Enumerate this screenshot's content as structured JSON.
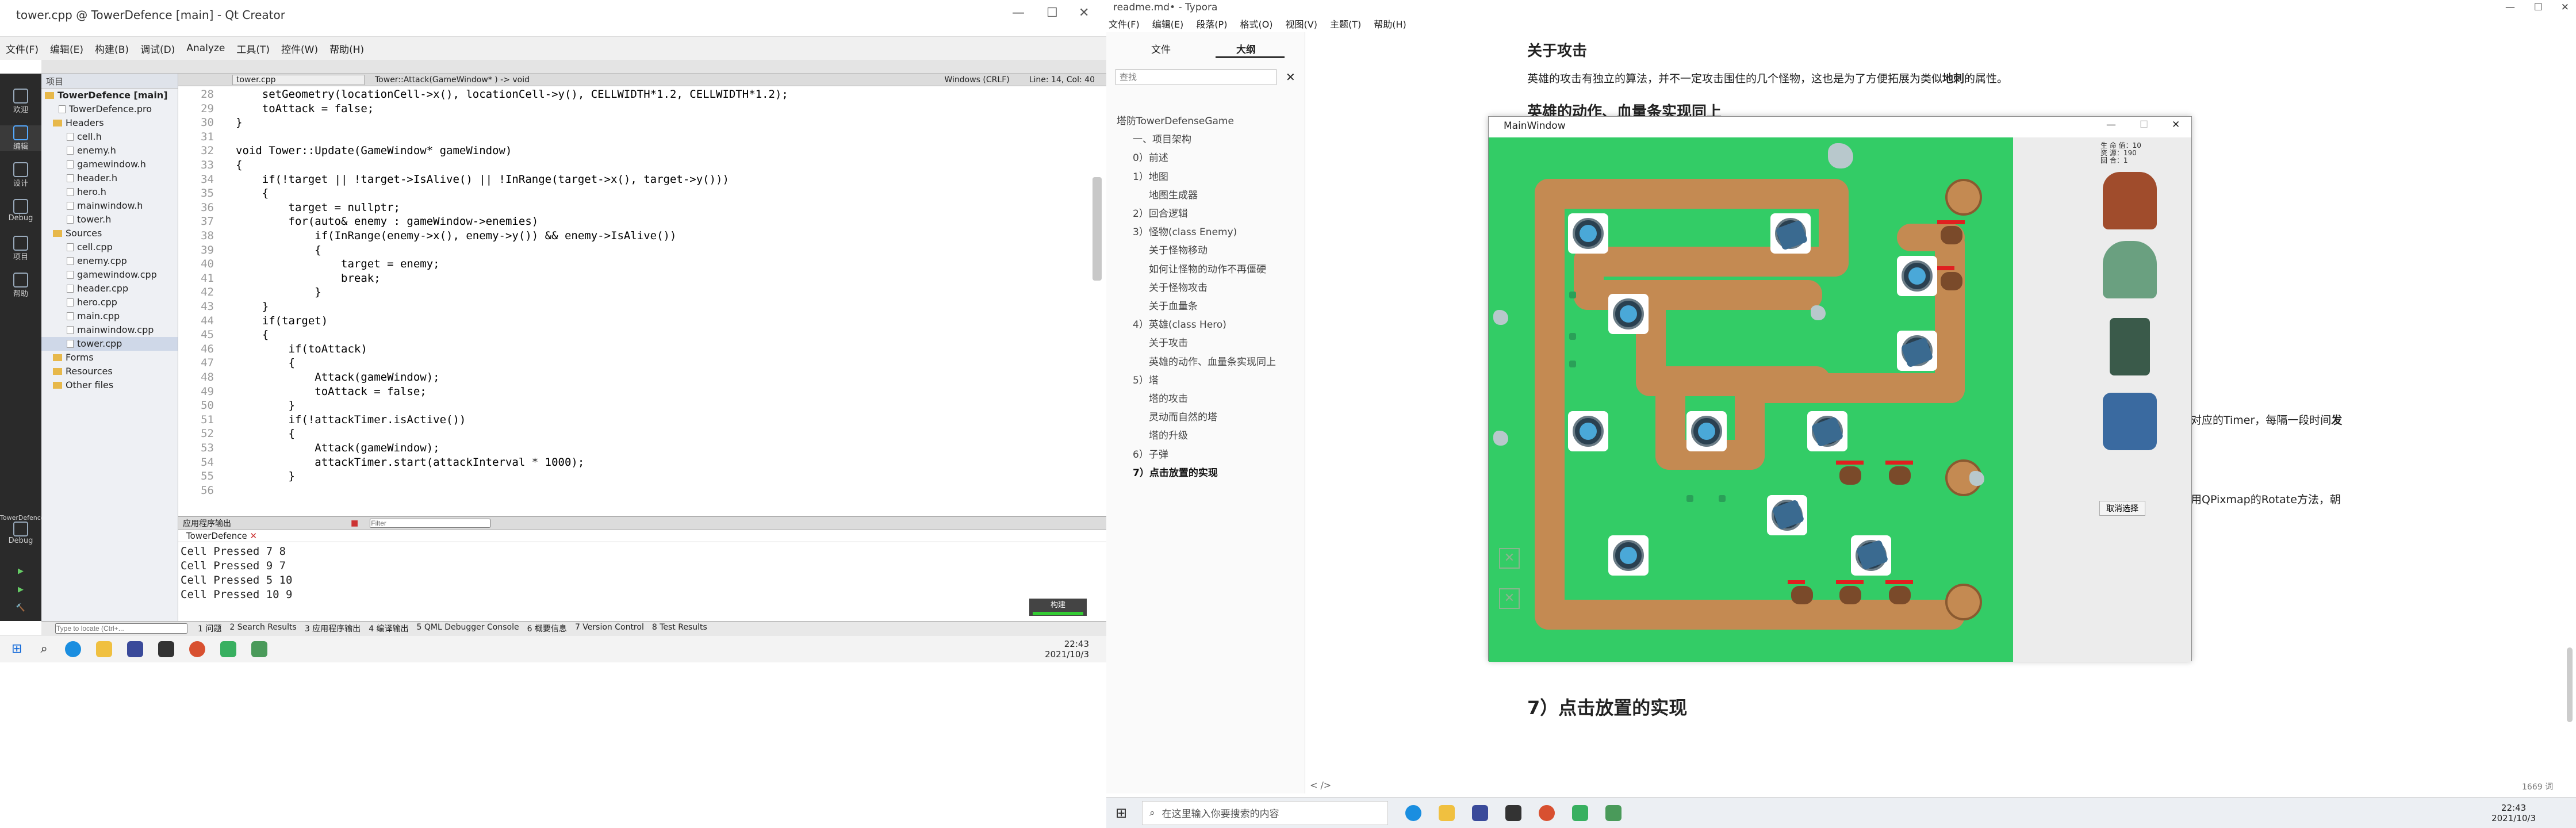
{
  "qt": {
    "title": "tower.cpp @ TowerDefence [main] - Qt Creator",
    "menu": [
      "文件(F)",
      "编辑(E)",
      "构建(B)",
      "调试(D)",
      "Analyze",
      "工具(T)",
      "控件(W)",
      "帮助(H)"
    ],
    "modes": [
      "欢迎",
      "编辑",
      "设计",
      "Debug",
      "项目",
      "帮助"
    ],
    "proj_header": "项目",
    "tree": [
      {
        "label": "TowerDefence [main]",
        "type": "root"
      },
      {
        "label": "TowerDefence.pro",
        "type": "file"
      },
      {
        "label": "Headers",
        "type": "folder"
      },
      {
        "label": "cell.h",
        "type": "file"
      },
      {
        "label": "enemy.h",
        "type": "file"
      },
      {
        "label": "gamewindow.h",
        "type": "file"
      },
      {
        "label": "header.h",
        "type": "file"
      },
      {
        "label": "hero.h",
        "type": "file"
      },
      {
        "label": "mainwindow.h",
        "type": "file"
      },
      {
        "label": "tower.h",
        "type": "file"
      },
      {
        "label": "Sources",
        "type": "folder"
      },
      {
        "label": "cell.cpp",
        "type": "file"
      },
      {
        "label": "enemy.cpp",
        "type": "file"
      },
      {
        "label": "gamewindow.cpp",
        "type": "file"
      },
      {
        "label": "header.cpp",
        "type": "file"
      },
      {
        "label": "hero.cpp",
        "type": "file"
      },
      {
        "label": "main.cpp",
        "type": "file"
      },
      {
        "label": "mainwindow.cpp",
        "type": "file"
      },
      {
        "label": "tower.cpp",
        "type": "file"
      },
      {
        "label": "Forms",
        "type": "folder"
      },
      {
        "label": "Resources",
        "type": "folder"
      },
      {
        "label": "Other files",
        "type": "folder"
      }
    ],
    "editor_file": "tower.cpp",
    "editor_symbol": "Tower::Attack(GameWindow* ) -> void",
    "editor_encoding": "Windows (CRLF)",
    "editor_pos": "Line: 14, Col: 40",
    "code": [
      {
        "n": "28",
        "t": "    setGeometry(locationCell->x(), locationCell->y(), CELLWIDTH*1.2, CELLWIDTH*1.2);"
      },
      {
        "n": "29",
        "t": "    toAttack = false;"
      },
      {
        "n": "30",
        "t": "}"
      },
      {
        "n": "31",
        "t": ""
      },
      {
        "n": "32",
        "t": "void Tower::Update(GameWindow* gameWindow)"
      },
      {
        "n": "33",
        "t": "{"
      },
      {
        "n": "34",
        "t": "    if(!target || !target->IsAlive() || !InRange(target->x(), target->y()))"
      },
      {
        "n": "35",
        "t": "    {"
      },
      {
        "n": "36",
        "t": "        target = nullptr;"
      },
      {
        "n": "37",
        "t": "        for(auto& enemy : gameWindow->enemies)"
      },
      {
        "n": "38",
        "t": "            if(InRange(enemy->x(), enemy->y()) && enemy->IsAlive())"
      },
      {
        "n": "39",
        "t": "            {"
      },
      {
        "n": "40",
        "t": "                target = enemy;"
      },
      {
        "n": "41",
        "t": "                break;"
      },
      {
        "n": "42",
        "t": "            }"
      },
      {
        "n": "43",
        "t": "    }"
      },
      {
        "n": "44",
        "t": "    if(target)"
      },
      {
        "n": "45",
        "t": "    {"
      },
      {
        "n": "46",
        "t": "        if(toAttack)"
      },
      {
        "n": "47",
        "t": "        {"
      },
      {
        "n": "48",
        "t": "            Attack(gameWindow);"
      },
      {
        "n": "49",
        "t": "            toAttack = false;"
      },
      {
        "n": "50",
        "t": "        }"
      },
      {
        "n": "51",
        "t": "        if(!attackTimer.isActive())"
      },
      {
        "n": "52",
        "t": "        {"
      },
      {
        "n": "53",
        "t": "            Attack(gameWindow);"
      },
      {
        "n": "54",
        "t": "            attackTimer.start(attackInterval * 1000);"
      },
      {
        "n": "55",
        "t": "        }"
      },
      {
        "n": "56",
        "t": ""
      }
    ],
    "output_header": "应用程序输出",
    "output_tab": "TowerDefence",
    "output_filter_placeholder": "Filter",
    "output_lines": [
      "Cell Pressed 7 8",
      "Cell Pressed 9 7",
      "Cell Pressed 5 10",
      "Cell Pressed 10 9"
    ],
    "build_badge": "构建",
    "locate_placeholder": "Type to locate (Ctrl+...",
    "status_tabs": [
      "1 问题",
      "2 Search Results",
      "3 应用程序输出",
      "4 编译输出",
      "5 QML Debugger Console",
      "6 概要信息",
      "7 Version Control",
      "8 Test Results"
    ],
    "left_kit": "TowerDefence",
    "left_kit_mode": "Debug",
    "clock_time": "22:43",
    "clock_date": "2021/10/3"
  },
  "typora": {
    "title": "readme.md• - Typora",
    "menu": [
      "文件(F)",
      "编辑(E)",
      "段落(P)",
      "格式(O)",
      "视图(V)",
      "主题(T)",
      "帮助(H)"
    ],
    "tabs": [
      "文件",
      "大纲"
    ],
    "search_placeholder": "查找",
    "outline": [
      {
        "t": "塔防TowerDefenseGame",
        "lvl": 0
      },
      {
        "t": "一、项目架构",
        "lvl": 1
      },
      {
        "t": "0）前述",
        "lvl": 1
      },
      {
        "t": "1）地图",
        "lvl": 1
      },
      {
        "t": "地图生成器",
        "lvl": 2
      },
      {
        "t": "2）回合逻辑",
        "lvl": 1
      },
      {
        "t": "3）怪物(class Enemy)",
        "lvl": 1
      },
      {
        "t": "关于怪物移动",
        "lvl": 2
      },
      {
        "t": "如何让怪物的动作不再僵硬",
        "lvl": 2
      },
      {
        "t": "关于怪物攻击",
        "lvl": 2
      },
      {
        "t": "关于血量条",
        "lvl": 2
      },
      {
        "t": "4）英雄(class Hero)",
        "lvl": 1
      },
      {
        "t": "关于攻击",
        "lvl": 2
      },
      {
        "t": "英雄的动作、血量条实现同上",
        "lvl": 2
      },
      {
        "t": "5）塔",
        "lvl": 1
      },
      {
        "t": "塔的攻击",
        "lvl": 2
      },
      {
        "t": "灵动而自然的塔",
        "lvl": 2
      },
      {
        "t": "塔的升级",
        "lvl": 2
      },
      {
        "t": "6）子弹",
        "lvl": 1
      },
      {
        "t": "7）点击放置的实现",
        "lvl": 1,
        "active": true
      }
    ],
    "h_attack": "关于攻击",
    "p_attack_a": "英雄的攻击有独立的算法，并不一定攻击围住的几个怪物，这也是为了方便拓展为类似",
    "p_attack_b": "地刺",
    "p_attack_c": "的属性。",
    "h_hero": "英雄的动作、血量条实现同上",
    "p_timer_a": "对应的Timer，每隔一段时间",
    "p_timer_b": "发",
    "p_rotate": "用QPixmap的Rotate方法，朝",
    "h_place": "7）点击放置的实现",
    "word_count": "1669 词",
    "footer_icons": "< />"
  },
  "game": {
    "title": "MainWindow",
    "stats": [
      "生 命 值：10",
      "资 源：190",
      "回 合：1"
    ],
    "cancel_button": "取消选择"
  },
  "taskbar_right": {
    "search_placeholder": "在这里输入你要搜索的内容",
    "time": "22:43",
    "date": "2021/10/3"
  }
}
